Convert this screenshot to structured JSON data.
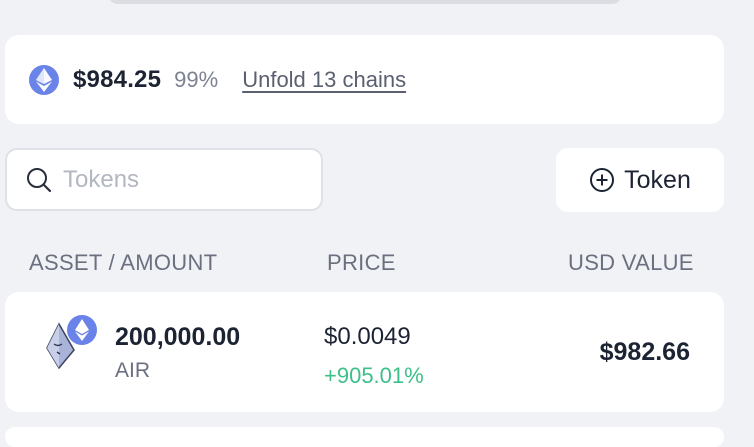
{
  "summary": {
    "total_value": "$984.25",
    "percent": "99%",
    "unfold_link": "Unfold 13 chains"
  },
  "search": {
    "placeholder": "Tokens",
    "value": ""
  },
  "add_token_button": {
    "label": "Token"
  },
  "table": {
    "columns": [
      "ASSET / AMOUNT",
      "PRICE",
      "USD VALUE"
    ],
    "rows": [
      {
        "amount": "200,000.00",
        "symbol": "AIR",
        "price": "$0.0049",
        "change": "+905.01%",
        "usd_value": "$982.66"
      }
    ]
  },
  "colors": {
    "eth_badge": "#6a83e8",
    "positive_change": "#3dbf8a",
    "background": "#f1f2f5"
  },
  "icons": [
    "ethereum-icon",
    "search-icon",
    "plus-circle-icon",
    "air-token-icon"
  ]
}
